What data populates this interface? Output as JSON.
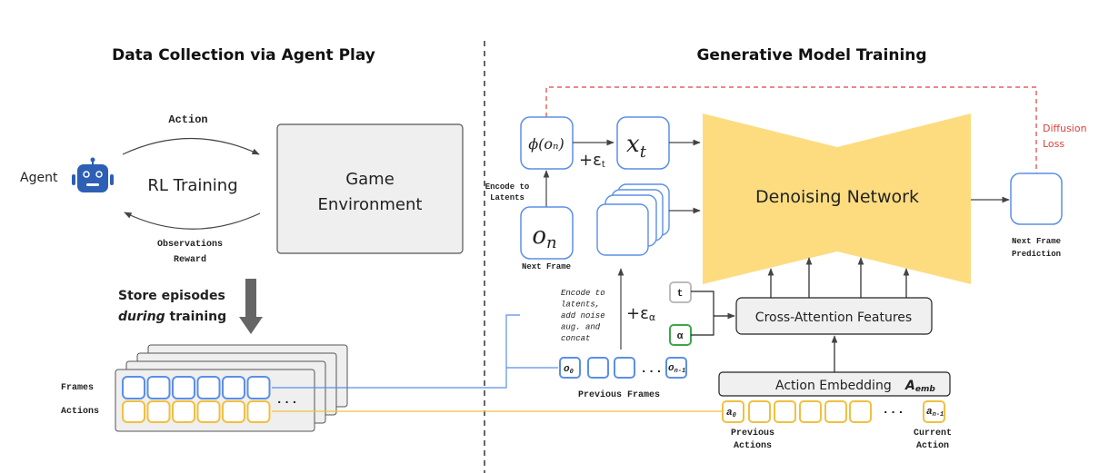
{
  "colors": {
    "frame_blue": "#5b8fe6",
    "action_yellow": "#f0c040",
    "context_green": "#3da64a",
    "network_yellow": "#fddc80",
    "loss_red": "#e0403c",
    "agent_blue": "#2d5fb5",
    "panel_gray": "#efefef"
  },
  "left": {
    "title": "Data Collection via Agent Play",
    "agent_label": "Agent",
    "agent_icon": "robot-icon",
    "rl_training": "RL Training",
    "action_label": "Action",
    "observations_label": "Observations",
    "reward_label": "Reward",
    "environment_line1": "Game",
    "environment_line2": "Environment",
    "store_line1": "Store episodes",
    "store_line2_italic": "during",
    "store_line2_rest": " training",
    "frames_label": "Frames",
    "actions_label": "Actions",
    "ellipsis": "..."
  },
  "right": {
    "title": "Generative Model Training",
    "phi_label": "ϕ(oₙ)",
    "xt_label": "x",
    "xt_sub": "t",
    "eps_t": "+ε",
    "eps_t_sub": "t",
    "encode_to_latents_1": "Encode to",
    "encode_to_latents_2": "Latents",
    "on_label": "o",
    "on_sub": "n",
    "next_frame_label": "Next Frame",
    "encode_lines": [
      "Encode to",
      "latents,",
      "add noise",
      "aug. and",
      "concat"
    ],
    "eps_a": "+ε",
    "eps_a_sub": "α",
    "t_token": "t",
    "alpha_token": "α",
    "denoising_network": "Denoising Network",
    "diffusion_loss_1": "Diffusion",
    "diffusion_loss_2": "Loss",
    "next_frame_prediction_1": "Next Frame",
    "next_frame_prediction_2": "Prediction",
    "cross_attention": "Cross-Attention Features",
    "action_embedding": "Action Embedding",
    "a_emb": "A",
    "a_emb_sub": "emb",
    "prev_frames_first": "o",
    "prev_frames_first_sub": "0",
    "prev_frames_last": "o",
    "prev_frames_last_sub": "n-1",
    "previous_frames_label": "Previous Frames",
    "prev_actions_first": "a",
    "prev_actions_first_sub": "0",
    "current_action": "a",
    "current_action_sub": "n-1",
    "previous_actions_1": "Previous",
    "previous_actions_2": "Actions",
    "current_action_1": "Current",
    "current_action_2": "Action",
    "ellipsis": "..."
  }
}
